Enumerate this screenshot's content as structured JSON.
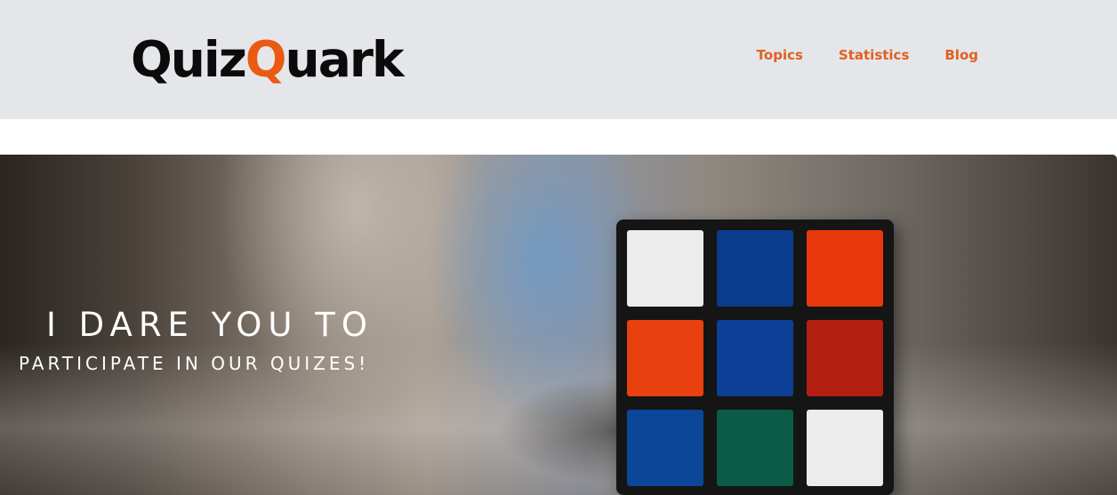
{
  "header": {
    "logo_part1": "Quiz",
    "logo_part2": "Q",
    "logo_part3": "uark",
    "nav": [
      "Topics",
      "Statistics",
      "Blog"
    ]
  },
  "hero": {
    "line1": "I DARE YOU TO",
    "line2": "PARTICIPATE IN OUR QUIZES!",
    "cube_colors": [
      [
        "#ececec",
        "#0a3c8e",
        "#e8380c"
      ],
      [
        "#e8400e",
        "#0c3f95",
        "#b31f12"
      ],
      [
        "#0b4699",
        "#0a5c46",
        "#ececec"
      ]
    ]
  },
  "colors": {
    "accent": "#ea5a13",
    "header_bg": "#e5e6ea"
  }
}
